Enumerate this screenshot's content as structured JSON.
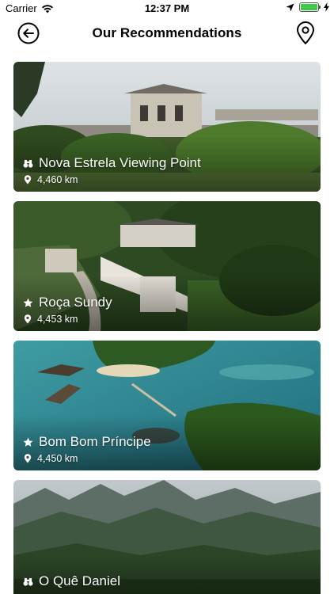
{
  "status_bar": {
    "carrier": "Carrier",
    "time": "12:37 PM"
  },
  "header": {
    "title": "Our Recommendations"
  },
  "recommendations": [
    {
      "name": "Nova Estrela Viewing Point",
      "distance": "4,460 km",
      "category_icon": "binoculars-icon"
    },
    {
      "name": "Roça Sundy",
      "distance": "4,453 km",
      "category_icon": "star-icon"
    },
    {
      "name": "Bom Bom Príncipe",
      "distance": "4,450 km",
      "category_icon": "star-icon"
    },
    {
      "name": "O Quê Daniel",
      "distance": "",
      "category_icon": "binoculars-icon"
    }
  ],
  "colors": {
    "battery": "#3fc94b",
    "text": "#000000"
  }
}
